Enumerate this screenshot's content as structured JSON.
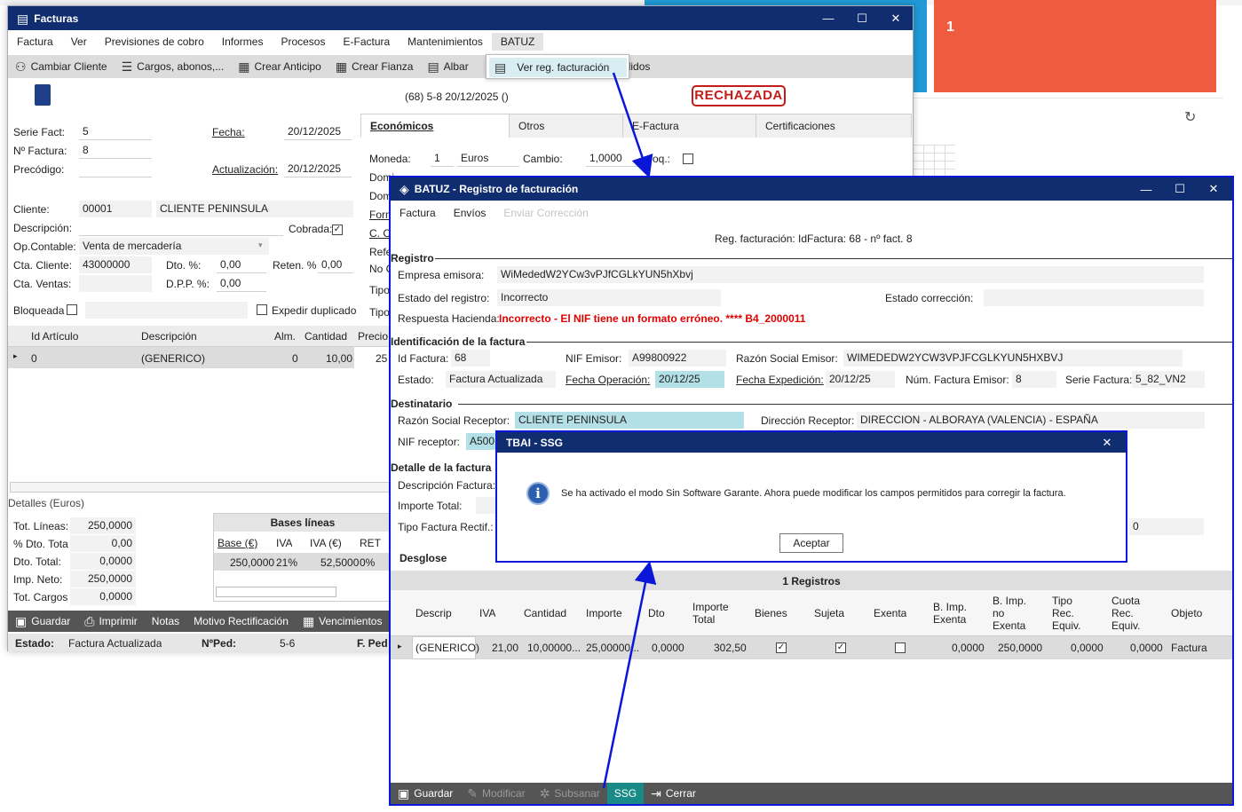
{
  "bg": {
    "red_tile_value": "1"
  },
  "facturas": {
    "title": "Facturas",
    "menu": [
      "Factura",
      "Ver",
      "Previsiones de cobro",
      "Informes",
      "Procesos",
      "E-Factura",
      "Mantenimientos",
      "BATUZ"
    ],
    "toolbar": {
      "cambiar_cliente": "Cambiar Cliente",
      "cargos": "Cargos, abonos,...",
      "crear_anticipo": "Crear Anticipo",
      "crear_fianza": "Crear Fianza",
      "albar": "Albar",
      "pedidos": "didos"
    },
    "popup_item": "Ver reg. facturación",
    "header_ref": "(68) 5-8  20/12/2025  ()",
    "stamp": "RECHAZADA",
    "labels": {
      "serie": "Serie Fact:",
      "numero": "Nº Factura:",
      "precodigo": "Precódigo:",
      "fecha": "Fecha:",
      "actualizacion": "Actualización:",
      "cliente": "Cliente:",
      "descripcion": "Descripción:",
      "cobrada": "Cobrada:",
      "opcontable": "Op.Contable:",
      "cta_cliente": "Cta. Cliente:",
      "dto": "Dto. %:",
      "reten": "Reten. %",
      "cta_ventas": "Cta. Ventas:",
      "dpp": "D.P.P. %:",
      "bloqueada": "Bloqueada",
      "expedir": "Expedir duplicado"
    },
    "values": {
      "serie": "5",
      "numero": "8",
      "fecha": "20/12/2025",
      "actualizacion": "20/12/2025",
      "cliente_code": "00001",
      "cliente_name": "CLIENTE PENINSULA",
      "opcontable": "Venta de mercadería",
      "cta_cliente": "43000000",
      "dto": "0,00",
      "reten": "0,00",
      "dpp": "0,00"
    },
    "tabs": [
      "Económicos",
      "Otros",
      "E-Factura",
      "Certificaciones"
    ],
    "econ": {
      "moneda_lbl": "Moneda:",
      "moneda_val": "1",
      "moneda_name": "Euros",
      "cambio_lbl": "Cambio:",
      "cambio_val": "1,0000",
      "bloq": "oq.:",
      "domi1": "Domi",
      "domi2": "Dom",
      "form": "Form",
      "cc": "C. C",
      "refe": "Refe",
      "nocu": "No C",
      "tipo1": "Tipo",
      "tipo2": "Tipo"
    },
    "lines_grid": {
      "headers": [
        "Id Artículo",
        "Descripción",
        "Alm.",
        "Cantidad",
        "Precio"
      ],
      "row": [
        "0",
        "(GENERICO)",
        "0",
        "10,00",
        "25"
      ]
    },
    "detalles": {
      "title": "Detalles (Euros)",
      "tot_lineas_lbl": "Tot. Líneas:",
      "tot_lineas": "250,0000",
      "dto_total_pct_lbl": "% Dto. Tota",
      "dto_total_pct": "0,00",
      "dto_total_lbl": "Dto. Total:",
      "dto_total": "0,0000",
      "imp_neto_lbl": "Imp. Neto:",
      "imp_neto": "250,0000",
      "tot_cargos_lbl": "Tot. Cargos",
      "tot_cargos": "0,0000"
    },
    "bases": {
      "title": "Bases líneas",
      "headers": [
        "Base (€)",
        "IVA",
        "IVA (€)",
        "RET"
      ],
      "row": [
        "250,0000",
        "21%",
        "52,5000",
        "0%"
      ]
    },
    "buttons": {
      "guardar": "Guardar",
      "imprimir": "Imprimir",
      "notas": "Notas",
      "motivo": "Motivo Rectificación",
      "vencimientos": "Vencimientos"
    },
    "status": {
      "estado_lbl": "Estado:",
      "estado": "Factura Actualizada",
      "nped_lbl": "NºPed:",
      "nped": "5-6",
      "fped_lbl": "F. Ped"
    }
  },
  "batuz": {
    "title": "BATUZ - Registro de facturación",
    "menu": [
      "Factura",
      "Envíos",
      "Enviar Corrección"
    ],
    "subtitle": "Reg. facturación: IdFactura: 68 - nº fact. 8",
    "registro": {
      "title": "Registro",
      "empresa_lbl": "Empresa emisora:",
      "empresa": "WiMededW2YCw3vPJfCGLkYUN5hXbvj",
      "estado_lbl": "Estado del registro:",
      "estado": "Incorrecto",
      "estado_corr_lbl": "Estado corrección:",
      "estado_corr": "",
      "respuesta_lbl": "Respuesta Hacienda:",
      "respuesta": "Incorrecto - El NIF tiene un formato erróneo.  **** B4_2000011"
    },
    "ident": {
      "title": "Identificación de la factura",
      "id_lbl": "Id Factura:",
      "id": "68",
      "nif_lbl": "NIF Emisor:",
      "nif": "A99800922",
      "razon_lbl": "Razón Social Emisor:",
      "razon": "WIMEDEDW2YCW3VPJFCGLKYUN5HXBVJ",
      "estado_lbl": "Estado:",
      "estado": "Factura Actualizada",
      "fop_lbl": "Fecha Operación:",
      "fop": "20/12/25",
      "fexp_lbl": "Fecha Expedición:",
      "fexp": "20/12/25",
      "num_lbl": "Núm. Factura Emisor:",
      "num": "8",
      "serie_lbl": "Serie Factura:",
      "serie": "5_82_VN2"
    },
    "dest": {
      "title": "Destinatario",
      "razon_lbl": "Razón Social Receptor:",
      "razon": "CLIENTE PENINSULA",
      "dir_lbl": "Dirección Receptor:",
      "dir": "DIRECCION - ALBORAYA (VALENCIA) - ESPAÑA",
      "nif_lbl": "NIF receptor:",
      "nif": "A500"
    },
    "detalle": {
      "title": "Detalle de la factura",
      "desc_lbl": "Descripción Factura:",
      "importe_lbl": "Importe Total:",
      "tipo_lbl": "Tipo Factura Rectif.:",
      "tipo_val_tail": "0"
    },
    "desglose": {
      "title": "Desglose",
      "count": "1 Registros",
      "headers": [
        "Descrip",
        "IVA",
        "Cantidad",
        "Importe",
        "Dto",
        "Importe Total",
        "Bienes",
        "Sujeta",
        "Exenta",
        "B. Imp. Exenta",
        "B. Imp. no Exenta",
        "Tipo Rec. Equiv.",
        "Cuota Rec. Equiv.",
        "Objeto"
      ],
      "row": [
        "(GENERICO)",
        "21,00",
        "10,00000...",
        "25,00000...",
        "0,0000",
        "302,50",
        "",
        "",
        "",
        "0,0000",
        "250,0000",
        "0,0000",
        "0,0000",
        "Factura"
      ]
    },
    "buttons": {
      "guardar": "Guardar",
      "modificar": "Modificar",
      "subsanar": "Subsanar",
      "ssg": "SSG",
      "cerrar": "Cerrar"
    }
  },
  "dialog": {
    "title": "TBAI - SSG",
    "message": "Se ha activado el modo Sin Software Garante. Ahora puede modificar los campos permitidos para corregir la factura.",
    "ok": "Aceptar"
  },
  "colors": {
    "titlebar": "#102e6f",
    "highlight": "#0a16d8",
    "stamp": "#c41b1b",
    "error": "#e00000",
    "ssg": "#1a8a86"
  }
}
